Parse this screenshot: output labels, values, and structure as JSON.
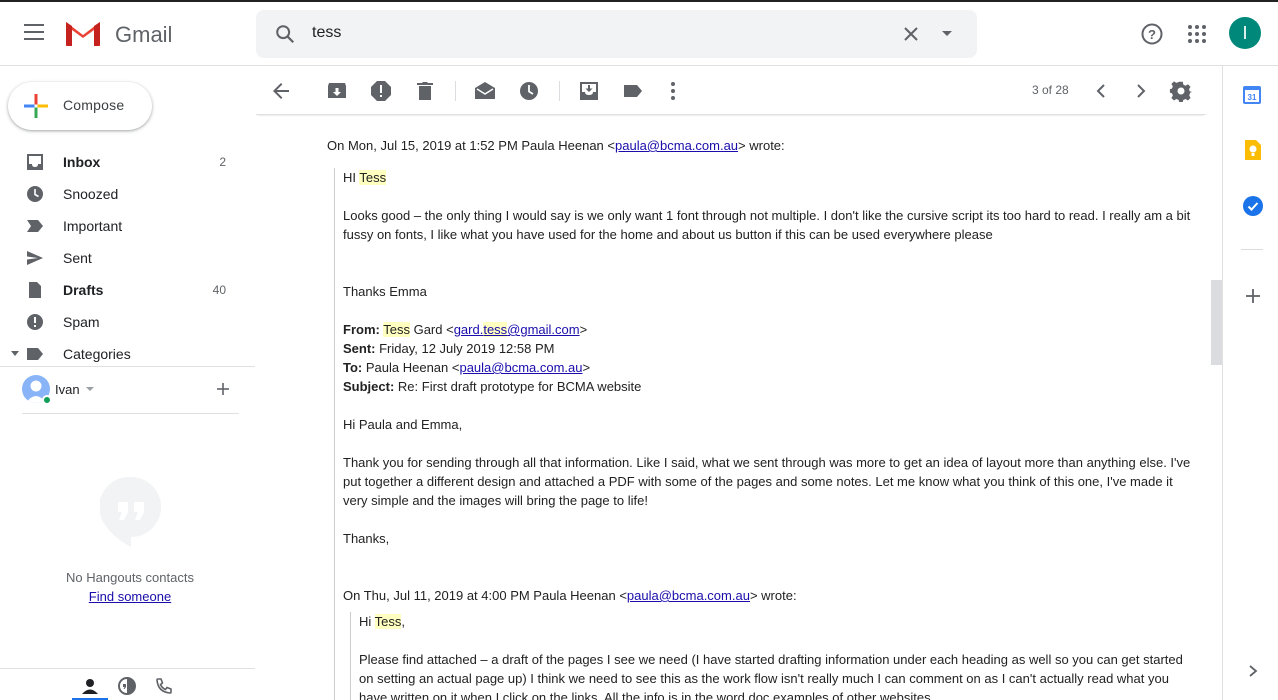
{
  "app": {
    "logo_text": "Gmail"
  },
  "search": {
    "query": "tess"
  },
  "user": {
    "initial": "I"
  },
  "compose": {
    "label": "Compose"
  },
  "nav": [
    {
      "id": "inbox",
      "label": "Inbox",
      "count": "2",
      "bold": true,
      "icon": "inbox-icon"
    },
    {
      "id": "snoozed",
      "label": "Snoozed",
      "count": "",
      "bold": false,
      "icon": "clock-icon"
    },
    {
      "id": "important",
      "label": "Important",
      "count": "",
      "bold": false,
      "icon": "important-icon"
    },
    {
      "id": "sent",
      "label": "Sent",
      "count": "",
      "bold": false,
      "icon": "send-icon"
    },
    {
      "id": "drafts",
      "label": "Drafts",
      "count": "40",
      "bold": true,
      "icon": "draft-icon"
    },
    {
      "id": "spam",
      "label": "Spam",
      "count": "",
      "bold": false,
      "icon": "spam-icon"
    },
    {
      "id": "categories",
      "label": "Categories",
      "count": "",
      "bold": false,
      "icon": "label-icon"
    }
  ],
  "hangouts": {
    "user_name": "Ivan",
    "empty_text": "No Hangouts contacts",
    "find_link": "Find someone"
  },
  "toolbar": {
    "pager": "3 of 28"
  },
  "message": {
    "header1": {
      "pre": "On Mon, Jul 15, 2019 at 1:52 PM Paula Heenan <",
      "email": "paula@bcma.com.au",
      "post": "> wrote:"
    },
    "greet1_pre": "HI ",
    "greet1_name": "Tess",
    "body1": "Looks good – the only thing I would say is we only want 1 font through not multiple. I don't like the cursive script its too hard to read. I really am a bit fussy on fonts, I like what you have used for the home and about us button if this can be used everywhere please",
    "sign1": "Thanks Emma",
    "from_label": "From:",
    "from_name_hl": "Tess",
    "from_rest": " Gard <",
    "from_email_a": "gard.",
    "from_email_hl": "tess",
    "from_email_b": "@gmail.com",
    "from_close": ">",
    "sent_label": "Sent:",
    "sent_value": " Friday, 12 July 2019 12:58 PM",
    "to_label": "To:",
    "to_pre": " Paula Heenan <",
    "to_email": "paula@bcma.com.au",
    "to_close": ">",
    "subject_label": "Subject:",
    "subject_value": " Re: First draft prototype for BCMA website",
    "greet2": "Hi Paula and Emma,",
    "body2": "Thank you for sending through all that information. Like I said, what we sent through was more to get an idea of layout more than anything else. I've put together a different design and attached a PDF with some of the pages and some notes. Let me know what you think of this one, I've made it very simple and the images will bring the page to life!",
    "sign2": "Thanks,",
    "header2": {
      "pre": "On Thu, Jul 11, 2019 at 4:00 PM Paula Heenan <",
      "email": "paula@bcma.com.au",
      "post": "> wrote:"
    },
    "greet3_pre": "Hi ",
    "greet3_name": "Tess",
    "greet3_post": ",",
    "body3": "Please find attached – a draft of the pages I see we need (I have started drafting information under each heading as well so you can get started on setting an actual page up) I think we need to see this as the work flow isn't really much I can comment on as I can't actually read what you have written on it when I click on the links. All the info is in the word doc examples of other websites"
  },
  "colors": {
    "accent": "#1a73e8",
    "highlight": "#ffffc0",
    "link": "#1a0dab"
  }
}
